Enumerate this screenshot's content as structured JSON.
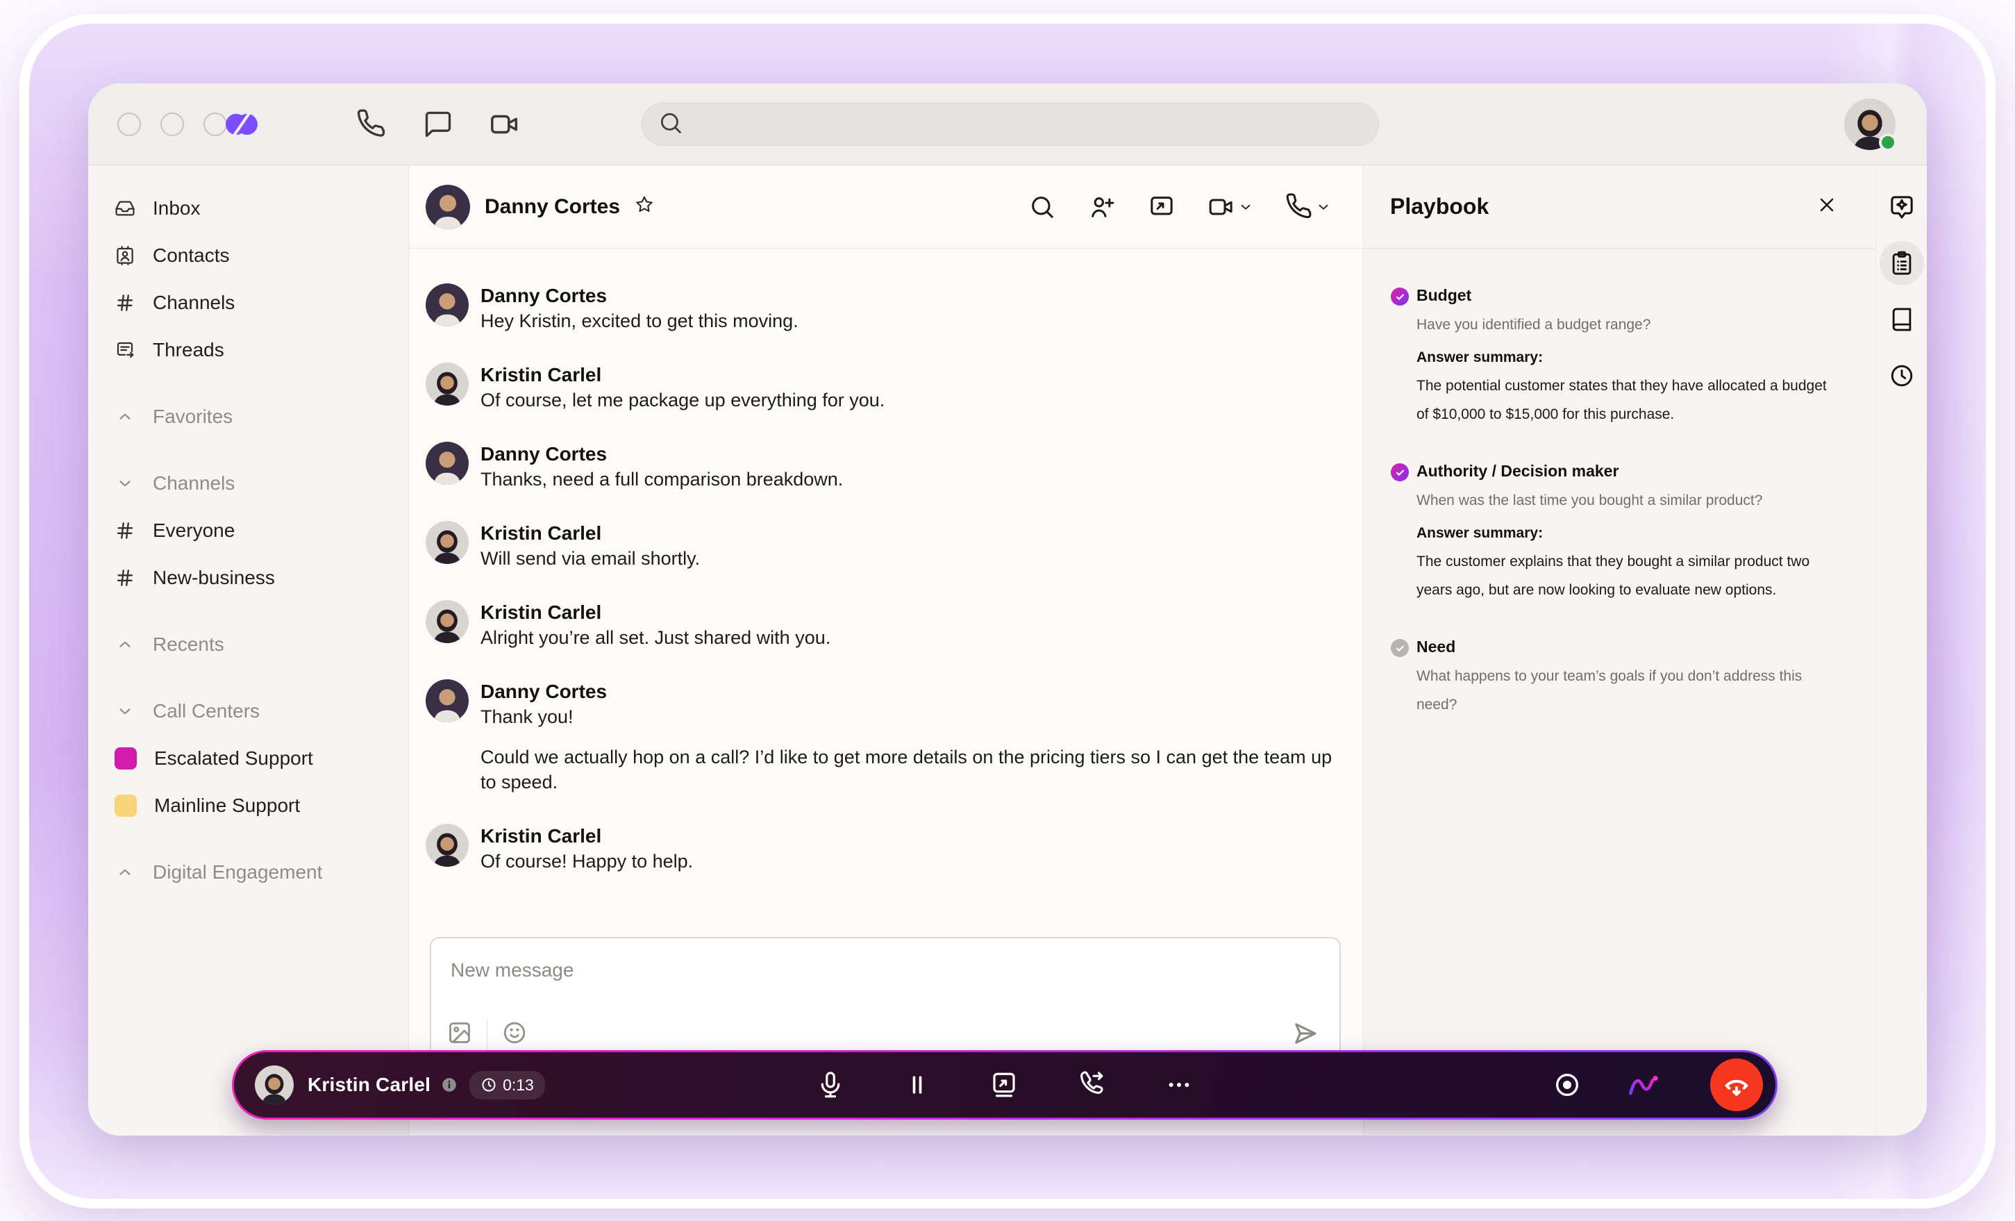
{
  "colors": {
    "accent_purple": "#7c4dff",
    "escalated_support_pink": "#d21bad",
    "mainline_support_yellow": "#f8d478",
    "status_green": "#27a447",
    "end_call_red": "#f5371f",
    "playbook_check_gradient_start": "#e0219f",
    "playbook_check_gradient_end": "#8a2fe8",
    "callbar_border_gradient_start": "#ef1fb4",
    "callbar_border_gradient_end": "#7a3ff2"
  },
  "topbar": {
    "search_placeholder": ""
  },
  "sidebar": {
    "items": [
      {
        "label": "Inbox"
      },
      {
        "label": "Contacts"
      },
      {
        "label": "Channels"
      },
      {
        "label": "Threads"
      }
    ],
    "favorites_label": "Favorites",
    "channels_label": "Channels",
    "channel_items": [
      {
        "label": "Everyone"
      },
      {
        "label": "New-business"
      }
    ],
    "recents_label": "Recents",
    "call_centers_label": "Call Centers",
    "call_center_items": [
      {
        "label": "Escalated Support",
        "color": "#d21bad"
      },
      {
        "label": "Mainline Support",
        "color": "#f8d478"
      }
    ],
    "digital_engagement_label": "Digital Engagement"
  },
  "chat": {
    "header": {
      "name": "Danny Cortes"
    },
    "messages": [
      {
        "author": "Danny Cortes",
        "paragraphs": [
          "Hey Kristin, excited to get this moving."
        ]
      },
      {
        "author": "Kristin Carlel",
        "paragraphs": [
          "Of course, let me package up everything for you."
        ]
      },
      {
        "author": "Danny Cortes",
        "paragraphs": [
          "Thanks, need a full comparison breakdown."
        ]
      },
      {
        "author": "Kristin Carlel",
        "paragraphs": [
          "Will send via email shortly."
        ]
      },
      {
        "author": "Kristin Carlel",
        "paragraphs": [
          "Alright you’re all set. Just shared with you."
        ]
      },
      {
        "author": "Danny Cortes",
        "paragraphs": [
          "Thank you!",
          "Could we actually hop on a call? I’d like to get more details on the pricing tiers so I can get the team up to speed."
        ]
      },
      {
        "author": "Kristin Carlel",
        "paragraphs": [
          "Of course! Happy to help."
        ]
      }
    ],
    "composer": {
      "placeholder": "New message"
    }
  },
  "playbook": {
    "title": "Playbook",
    "sections": [
      {
        "status": "complete",
        "title": "Budget",
        "question": "Have you identified a budget range?",
        "answer_label": "Answer summary:",
        "answer": "The potential customer states that they have allocated a budget of $10,000 to $15,000 for this purchase."
      },
      {
        "status": "complete",
        "title": "Authority / Decision maker",
        "question": "When was the last time you bought a similar product?",
        "answer_label": "Answer summary:",
        "answer": "The customer explains that they bought a similar product two years ago, but are now looking to evaluate new options."
      },
      {
        "status": "pending",
        "title": "Need",
        "question": "What happens to your team’s goals if you don’t address this need?"
      }
    ]
  },
  "call_bar": {
    "participant": "Kristin Carlel",
    "duration": "0:13"
  }
}
